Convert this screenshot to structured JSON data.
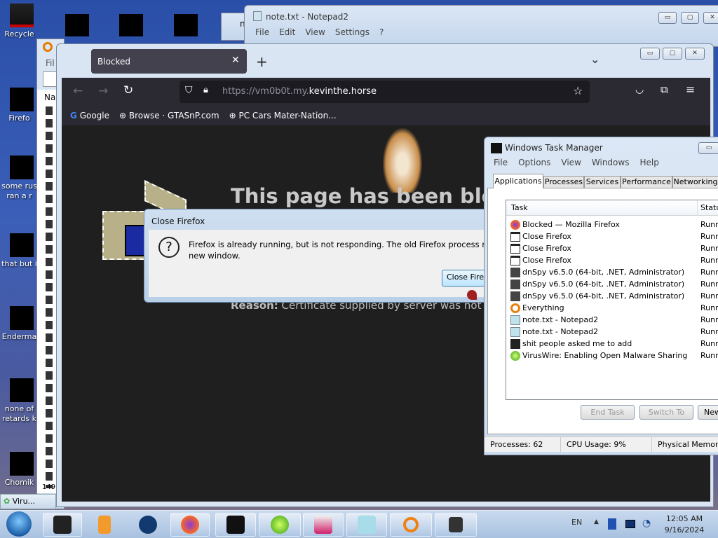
{
  "desktop": {
    "icons": [
      {
        "label": "Recycle"
      },
      {
        "label": "Firefo"
      },
      {
        "label": "some rus\nran a r"
      },
      {
        "label": "that but i"
      },
      {
        "label": "Enderma"
      },
      {
        "label": "none of\nretards k"
      },
      {
        "label": "Chomik"
      }
    ]
  },
  "notepad": {
    "title": "note.txt - Notepad2",
    "menu": [
      "File",
      "Edit",
      "View",
      "Settings",
      "?"
    ],
    "other_title": "n"
  },
  "everything": {
    "menu_file": "Fil",
    "col_name": "Nam",
    "status": "149,"
  },
  "firefox": {
    "tab_title": "Blocked",
    "url_prefix": "https://vm0b0t.my.",
    "url_domain": "kevinthe.horse",
    "bookmarks": [
      "Google",
      "Browse · GTASnP.com",
      "PC Cars Mater-Nation..."
    ],
    "page_heading": "This page has been bloc",
    "reason_label": "Reason:",
    "reason_text": " Certificate supplied by server was not vali"
  },
  "close_dialog": {
    "title": "Close Firefox",
    "message": "Firefox is already running, but is not responding. The old Firefox process must be",
    "message_line2": "new window.",
    "button": "Close Firef"
  },
  "task_manager": {
    "title": "Windows Task Manager",
    "menu": [
      "File",
      "Options",
      "View",
      "Windows",
      "Help"
    ],
    "tabs": [
      "Applications",
      "Processes",
      "Services",
      "Performance",
      "Networking"
    ],
    "active_tab": "Applications",
    "columns": [
      "Task",
      "Statu"
    ],
    "rows": [
      {
        "task": "Blocked — Mozilla Firefox",
        "status": "Runn",
        "icon": "firefox-icon"
      },
      {
        "task": "Close Firefox",
        "status": "Runn",
        "icon": "window-icon"
      },
      {
        "task": "Close Firefox",
        "status": "Runn",
        "icon": "window-icon"
      },
      {
        "task": "Close Firefox",
        "status": "Runn",
        "icon": "window-icon"
      },
      {
        "task": "dnSpy v6.5.0 (64-bit, .NET, Administrator)",
        "status": "Runn",
        "icon": "dnspy-icon"
      },
      {
        "task": "dnSpy v6.5.0 (64-bit, .NET, Administrator)",
        "status": "Runn",
        "icon": "dnspy-icon"
      },
      {
        "task": "dnSpy v6.5.0 (64-bit, .NET, Administrator)",
        "status": "Runn",
        "icon": "dnspy-icon"
      },
      {
        "task": "Everything",
        "status": "Runn",
        "icon": "search-icon"
      },
      {
        "task": "note.txt - Notepad2",
        "status": "Runn",
        "icon": "notepad-icon"
      },
      {
        "task": "note.txt - Notepad2",
        "status": "Runn",
        "icon": "notepad-icon"
      },
      {
        "task": "shit people asked me to add",
        "status": "Runn",
        "icon": "folder-icon"
      },
      {
        "task": "VirusWire: Enabling Open Malware Sharing",
        "status": "Runn",
        "icon": "virus-icon"
      }
    ],
    "buttons": {
      "end_task": "End Task",
      "switch_to": "Switch To",
      "new": "New"
    },
    "status": {
      "processes": "Processes: 62",
      "cpu": "CPU Usage: 9%",
      "memory": "Physical Memory"
    }
  },
  "mini_item": "Viru...",
  "taskbar": {
    "lang": "EN",
    "time": "12:05 AM",
    "date": "9/16/2024"
  }
}
